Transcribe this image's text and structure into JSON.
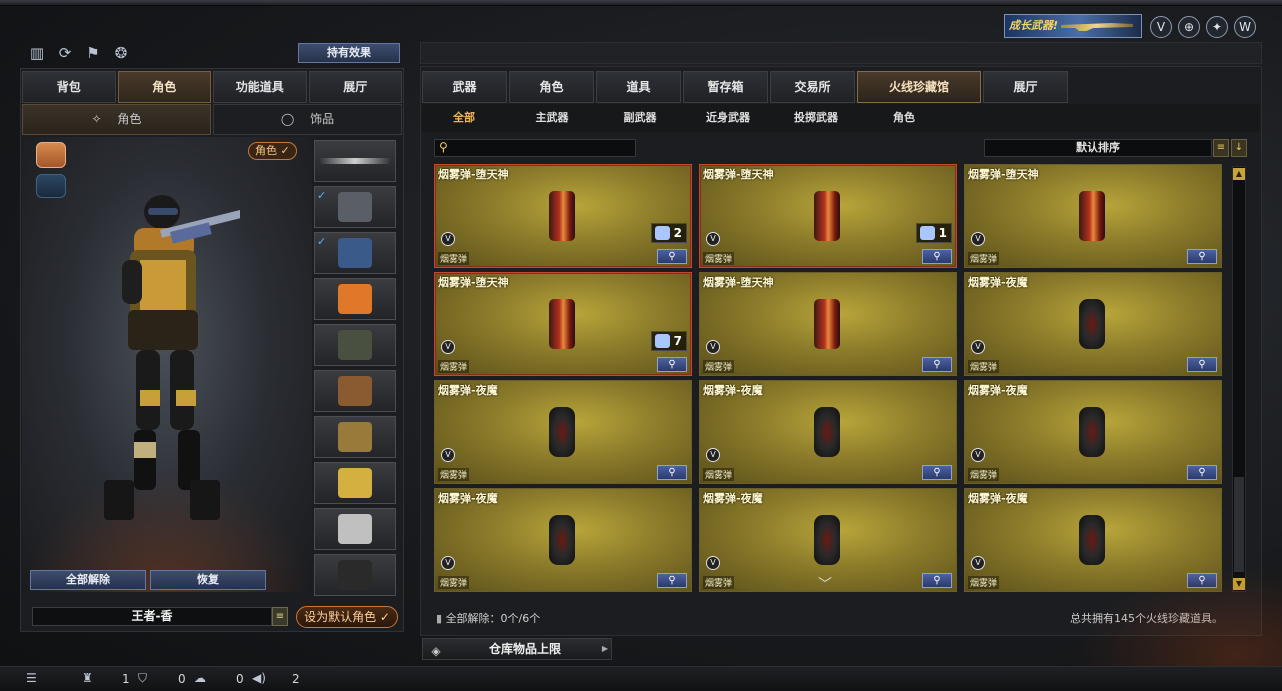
{
  "top": {
    "left_icons": [
      "stats-icon",
      "refresh-icon",
      "run-icon",
      "money-bag-icon"
    ],
    "hold_effect_btn": "持有效果",
    "promo_text": "成长武器!",
    "right_icons": [
      "shield-v-icon",
      "crosshair-icon",
      "medal-icon",
      "w-logo-icon"
    ]
  },
  "left": {
    "tabs": [
      {
        "label": "背包",
        "active": false
      },
      {
        "label": "角色",
        "active": true
      },
      {
        "label": "功能道具",
        "active": false
      },
      {
        "label": "展厅",
        "active": false
      }
    ],
    "subtabs": [
      {
        "label": "角色",
        "icon": "character-sparkle-icon",
        "active": true
      },
      {
        "label": "饰品",
        "icon": "ring-icon",
        "active": false
      }
    ],
    "char_badge": "角色 ✓",
    "clear_all_btn": "全部解除",
    "restore_btn": "恢复",
    "character_name": "王者-香",
    "list_btn": "≡",
    "set_default_btn": "设为默认角色 ✓"
  },
  "slots": [
    {
      "name": "slot-sniper-rifle",
      "color": "#cfcfcf",
      "checked": false
    },
    {
      "name": "slot-helmet",
      "color": "#5a5e66",
      "checked": true
    },
    {
      "name": "slot-goggles",
      "color": "#3a5a8a",
      "checked": true
    },
    {
      "name": "slot-pumpkin-doll",
      "color": "#e0782a",
      "checked": false
    },
    {
      "name": "slot-backpack",
      "color": "#4a5040",
      "checked": false
    },
    {
      "name": "slot-pouch",
      "color": "#8a5a30",
      "checked": false
    },
    {
      "name": "slot-ammo-belt",
      "color": "#9a7a3a",
      "checked": false
    },
    {
      "name": "slot-golden-dragon",
      "color": "#d4b040",
      "checked": false
    },
    {
      "name": "slot-silver-dragon",
      "color": "#c0c0c0",
      "checked": false
    },
    {
      "name": "slot-empty",
      "color": "#2a2a2a",
      "checked": false
    }
  ],
  "right": {
    "tabs": [
      {
        "label": "武器",
        "active": false,
        "wide": false
      },
      {
        "label": "角色",
        "active": false,
        "wide": false
      },
      {
        "label": "道具",
        "active": false,
        "wide": false
      },
      {
        "label": "暂存箱",
        "active": false,
        "wide": false
      },
      {
        "label": "交易所",
        "active": false,
        "wide": false
      },
      {
        "label": "火线珍藏馆",
        "active": true,
        "wide": true
      },
      {
        "label": "展厅",
        "active": false,
        "wide": false
      }
    ],
    "subtabs": [
      {
        "label": "全部",
        "active": true
      },
      {
        "label": "主武器",
        "active": false
      },
      {
        "label": "副武器",
        "active": false
      },
      {
        "label": "近身武器",
        "active": false
      },
      {
        "label": "投掷武器",
        "active": false
      },
      {
        "label": "角色",
        "active": false
      }
    ],
    "search_placeholder": "",
    "sort_label": "默认排序",
    "items": [
      {
        "name": "烟雾弹-堕天神",
        "type": "烟雾弹",
        "variant": "red",
        "highlight": true,
        "count": "2"
      },
      {
        "name": "烟雾弹-堕天神",
        "type": "烟雾弹",
        "variant": "red",
        "highlight": true,
        "count": "1"
      },
      {
        "name": "烟雾弹-堕天神",
        "type": "烟雾弹",
        "variant": "red",
        "highlight": false,
        "count": ""
      },
      {
        "name": "烟雾弹-堕天神",
        "type": "烟雾弹",
        "variant": "red",
        "highlight": true,
        "count": "7"
      },
      {
        "name": "烟雾弹-堕天神",
        "type": "烟雾弹",
        "variant": "red",
        "highlight": false,
        "count": ""
      },
      {
        "name": "烟雾弹-夜魔",
        "type": "烟雾弹",
        "variant": "dark",
        "highlight": false,
        "count": ""
      },
      {
        "name": "烟雾弹-夜魔",
        "type": "烟雾弹",
        "variant": "dark",
        "highlight": false,
        "count": ""
      },
      {
        "name": "烟雾弹-夜魔",
        "type": "烟雾弹",
        "variant": "dark",
        "highlight": false,
        "count": ""
      },
      {
        "name": "烟雾弹-夜魔",
        "type": "烟雾弹",
        "variant": "dark",
        "highlight": false,
        "count": ""
      },
      {
        "name": "烟雾弹-夜魔",
        "type": "烟雾弹",
        "variant": "dark",
        "highlight": false,
        "count": ""
      },
      {
        "name": "烟雾弹-夜魔",
        "type": "烟雾弹",
        "variant": "dark",
        "highlight": false,
        "count": ""
      },
      {
        "name": "烟雾弹-夜魔",
        "type": "烟雾弹",
        "variant": "dark",
        "highlight": false,
        "count": ""
      }
    ],
    "footer_left": "全部解除：0个/6个",
    "footer_right": "总共拥有145个火线珍藏道具。",
    "warehouse_btn": "仓库物品上限"
  },
  "statusbar": {
    "items": [
      {
        "icon": "list-icon",
        "value": ""
      },
      {
        "icon": "team-icon",
        "value": "1"
      },
      {
        "icon": "shield-icon",
        "value": "0"
      },
      {
        "icon": "chat-icon",
        "value": "0"
      },
      {
        "icon": "speaker-icon",
        "value": "2"
      }
    ]
  },
  "colors": {
    "accent_gold": "#f2b35a",
    "card_gold": "#b8a53a",
    "highlight_border": "#c24a2a",
    "button_blue": "#2a3a6c"
  }
}
